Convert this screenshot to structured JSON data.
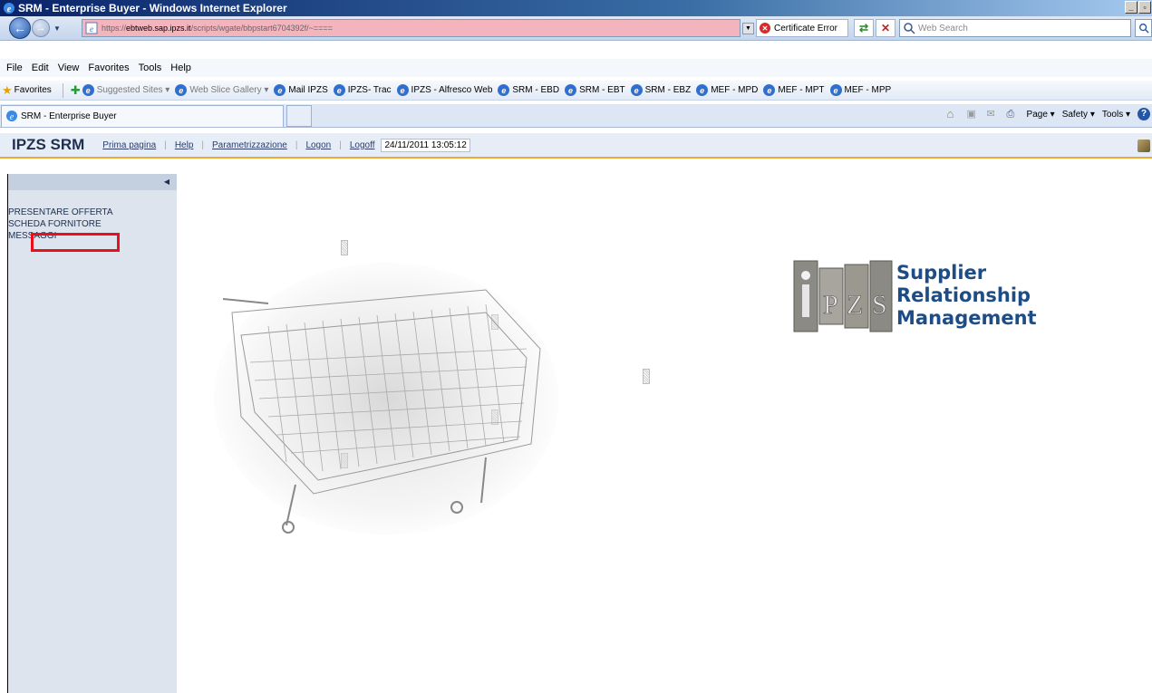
{
  "window": {
    "title": "SRM - Enterprise Buyer - Windows Internet Explorer"
  },
  "addressbar": {
    "url_prefix": "https://",
    "url_host": "ebtweb.sap.ipzs.it",
    "url_path": "/scripts/wgate/bbpstart6704392f/~====",
    "cert_error": "Certificate Error",
    "search_placeholder": "Web Search"
  },
  "menubar": {
    "items": [
      "File",
      "Edit",
      "View",
      "Favorites",
      "Tools",
      "Help"
    ]
  },
  "favorites": {
    "label": "Favorites",
    "items": [
      "Suggested Sites ▾",
      "Web Slice Gallery ▾",
      "Mail IPZS",
      "IPZS- Trac",
      "IPZS - Alfresco Web",
      "SRM - EBD",
      "SRM - EBT",
      "SRM - EBZ",
      "MEF - MPD",
      "MEF - MPT",
      "MEF - MPP"
    ]
  },
  "tabs": {
    "active_label": "SRM - Enterprise Buyer"
  },
  "commandbar": {
    "page": "Page ▾",
    "safety": "Safety ▾",
    "tools": "Tools ▾"
  },
  "srm": {
    "brand": "IPZS SRM",
    "links": [
      "Prima pagina",
      "Help",
      "Parametrizzazione",
      "Logon",
      "Logoff"
    ],
    "datetime": "24/11/2011 13:05:12"
  },
  "leftnav": {
    "items": [
      "PRESENTARE OFFERTA",
      "SCHEDA FORNITORE",
      "MESSAGGI"
    ]
  },
  "logo": {
    "mark": "iPZS",
    "line1": "Supplier",
    "line2": "Relationship",
    "line3": "Management"
  }
}
